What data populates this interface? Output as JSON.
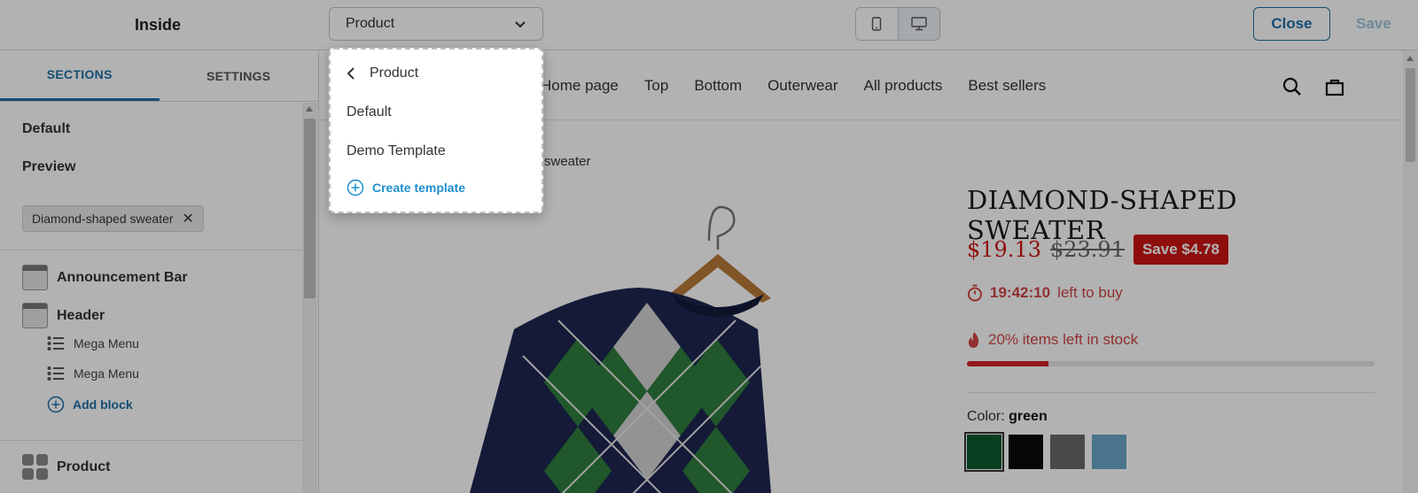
{
  "topbar": {
    "brand": "Inside",
    "template_select": {
      "value": "Product"
    },
    "device_toggle": {
      "mobile_icon": "mobile-icon",
      "desktop_icon": "desktop-icon",
      "selected": "desktop"
    },
    "close_label": "Close",
    "save_label": "Save"
  },
  "sidebar": {
    "tabs": [
      {
        "label": "SECTIONS",
        "active": true
      },
      {
        "label": "SETTINGS",
        "active": false
      }
    ],
    "template_default": "Default",
    "preview_label": "Preview",
    "preview_chip": "Diamond-shaped sweater",
    "sections": [
      {
        "label": "Announcement Bar",
        "icon": "section-layout-icon"
      },
      {
        "label": "Header",
        "icon": "section-layout-icon"
      }
    ],
    "blocks": [
      {
        "label": "Mega Menu",
        "icon": "list-icon"
      },
      {
        "label": "Mega Menu",
        "icon": "list-icon"
      }
    ],
    "add_block_label": "Add block",
    "product_section": {
      "label": "Product",
      "icon": "grid-icon"
    }
  },
  "preview": {
    "nav_links": [
      "Home page",
      "Top",
      "Bottom",
      "Outerwear",
      "All products",
      "Best sellers"
    ],
    "breadcrumb_tail": "sweater",
    "product": {
      "title": "DIAMOND-SHAPED SWEATER",
      "price": "$19.13",
      "compare_price": "$23.91",
      "save_badge": "Save $4.78",
      "timer": "19:42:10",
      "timer_suffix": "left to buy",
      "stock_text": "20% items left in stock",
      "stock_fraction": 0.2,
      "color_label": "Color:",
      "color_value": "green",
      "swatches": [
        {
          "name": "green",
          "color": "#0b5a2e",
          "selected": true
        },
        {
          "name": "black",
          "color": "#0a0a0a",
          "selected": false
        },
        {
          "name": "grey",
          "color": "#6b6b6b",
          "selected": false
        },
        {
          "name": "blue",
          "color": "#6aa6c7",
          "selected": false
        }
      ]
    }
  },
  "dropdown": {
    "back_label": "Product",
    "items": [
      "Default",
      "Demo Template"
    ],
    "create_label": "Create template"
  },
  "colors": {
    "accent": "#1d6fa8",
    "sale_red": "#cc1515",
    "link_blue": "#1d8fcc"
  }
}
